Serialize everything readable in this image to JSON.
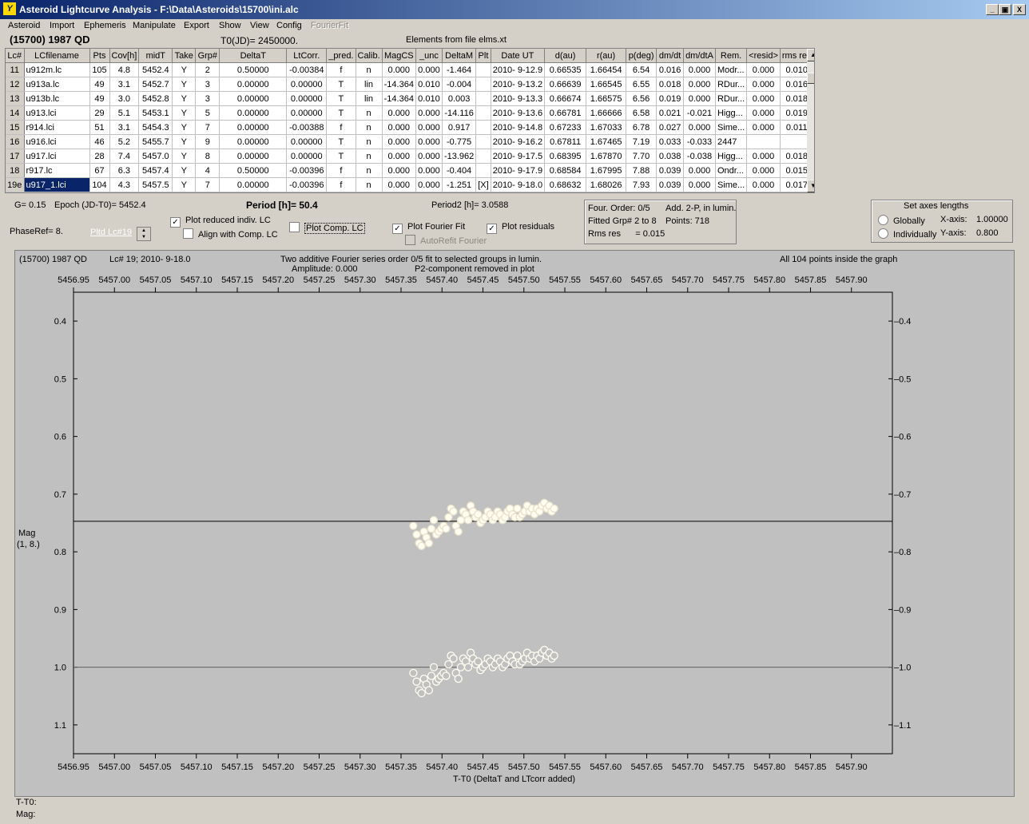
{
  "window": {
    "title": "Asteroid Lightcurve Analysis - F:\\Data\\Asteroids\\15700\\ini.alc",
    "buttons": [
      "_",
      "▣",
      "X"
    ]
  },
  "menu": [
    "Asteroid",
    "Import",
    "Ephemeris",
    "Manipulate",
    "Export",
    "Show",
    "View",
    "Config",
    "FourierFit"
  ],
  "header": {
    "asteroid": "(15700) 1987 QD",
    "t0": "T0(JD)= 2450000.",
    "elements": "Elements from file elms.xt"
  },
  "table": {
    "columns": [
      "Lc#",
      "LCfilename",
      "Pts",
      "Cov[h]",
      "midT",
      "Take",
      "Grp#",
      "DeltaT",
      "LtCorr.",
      "_pred.",
      "Calib.",
      "MagCS",
      "_unc",
      "DeltaM",
      "Plt",
      "Date UT",
      "d(au)",
      "r(au)",
      "p(deg)",
      "dm/dt",
      "dm/dtA",
      "Rem.",
      "<resid>",
      "rms res"
    ],
    "rows": [
      [
        "11",
        "u912m.lc",
        "105",
        "4.8",
        "5452.4",
        "Y",
        "2",
        "0.50000",
        "-0.00384",
        "f",
        "n",
        "0.000",
        "0.000",
        "-1.464",
        "",
        "2010- 9-12.9",
        "0.66535",
        "1.66454",
        "6.54",
        "0.016",
        "0.000",
        "Modr...",
        "0.000",
        "0.010"
      ],
      [
        "12",
        "u913a.lc",
        "49",
        "3.1",
        "5452.7",
        "Y",
        "3",
        "0.00000",
        "0.00000",
        "T",
        "lin",
        "-14.364",
        "0.010",
        "-0.004",
        "",
        "2010- 9-13.2",
        "0.66639",
        "1.66545",
        "6.55",
        "0.018",
        "0.000",
        "RDur...",
        "0.000",
        "0.016"
      ],
      [
        "13",
        "u913b.lc",
        "49",
        "3.0",
        "5452.8",
        "Y",
        "3",
        "0.00000",
        "0.00000",
        "T",
        "lin",
        "-14.364",
        "0.010",
        "0.003",
        "",
        "2010- 9-13.3",
        "0.66674",
        "1.66575",
        "6.56",
        "0.019",
        "0.000",
        "RDur...",
        "0.000",
        "0.018"
      ],
      [
        "14",
        "u913.lci",
        "29",
        "5.1",
        "5453.1",
        "Y",
        "5",
        "0.00000",
        "0.00000",
        "T",
        "n",
        "0.000",
        "0.000",
        "-14.116",
        "",
        "2010- 9-13.6",
        "0.66781",
        "1.66666",
        "6.58",
        "0.021",
        "-0.021",
        "Higg...",
        "0.000",
        "0.019"
      ],
      [
        "15",
        "r914.lci",
        "51",
        "3.1",
        "5454.3",
        "Y",
        "7",
        "0.00000",
        "-0.00388",
        "f",
        "n",
        "0.000",
        "0.000",
        "0.917",
        "",
        "2010- 9-14.8",
        "0.67233",
        "1.67033",
        "6.78",
        "0.027",
        "0.000",
        "Sime...",
        "0.000",
        "0.011"
      ],
      [
        "16",
        "u916.lci",
        "46",
        "5.2",
        "5455.7",
        "Y",
        "9",
        "0.00000",
        "0.00000",
        "T",
        "n",
        "0.000",
        "0.000",
        "-0.775",
        "",
        "2010- 9-16.2",
        "0.67811",
        "1.67465",
        "7.19",
        "0.033",
        "-0.033",
        "2447",
        "",
        ""
      ],
      [
        "17",
        "u917.lci",
        "28",
        "7.4",
        "5457.0",
        "Y",
        "8",
        "0.00000",
        "0.00000",
        "T",
        "n",
        "0.000",
        "0.000",
        "-13.962",
        "",
        "2010- 9-17.5",
        "0.68395",
        "1.67870",
        "7.70",
        "0.038",
        "-0.038",
        "Higg...",
        "0.000",
        "0.018"
      ],
      [
        "18",
        "r917.lc",
        "67",
        "6.3",
        "5457.4",
        "Y",
        "4",
        "0.50000",
        "-0.00396",
        "f",
        "n",
        "0.000",
        "0.000",
        "-0.404",
        "",
        "2010- 9-17.9",
        "0.68584",
        "1.67995",
        "7.88",
        "0.039",
        "0.000",
        "Ondr...",
        "0.000",
        "0.015"
      ],
      [
        "19e",
        "u917_1.lci",
        "104",
        "4.3",
        "5457.5",
        "Y",
        "7",
        "0.00000",
        "-0.00396",
        "f",
        "n",
        "0.000",
        "0.000",
        "-1.251",
        "[X]",
        "2010- 9-18.0",
        "0.68632",
        "1.68026",
        "7.93",
        "0.039",
        "0.000",
        "Sime...",
        "0.000",
        "0.017"
      ]
    ]
  },
  "controls": {
    "g_value": "G= 0.15",
    "epoch": "Epoch (JD-T0)= 5452.4",
    "period": "Period [h]= 50.4",
    "period2": "Period2 [h]= 3.0588",
    "phaseref": "PhaseRef= 8.",
    "pltd_lc": "Pltd Lc#19",
    "plot_reduced": "Plot reduced indiv. LC",
    "align_comp": "Align with Comp. LC",
    "plot_comp": "Plot Comp. LC",
    "plot_fourier": "Plot Fourier Fit",
    "autorefit": "AutoRefit Fourier",
    "plot_residuals": "Plot residuals"
  },
  "fourier_info": {
    "order": "Four. Order:  0/5",
    "mode": "Add. 2-P, in lumin.",
    "fitted": "Fitted Grp# 2 to 8",
    "points": "Points: 718",
    "rms": "Rms res      = 0.015"
  },
  "axes_box": {
    "title": "Set axes lengths",
    "globally": "Globally",
    "individually": "Individually",
    "x_label": "X-axis:",
    "x_value": "1.00000",
    "y_label": "Y-axis:",
    "y_value": "0.800"
  },
  "plot": {
    "asteroid": "(15700) 1987 QD",
    "lc_info": "Lc# 19; 2010- 9-18.0",
    "fit_desc": "Two additive Fourier series order 0/5 fit to selected groups in lumin.",
    "amplitude": "Amplitude: 0.000",
    "p2_removed": "P2-component removed in plot",
    "points_inside": "All 104 points inside the graph",
    "ylabel_1": "Mag",
    "ylabel_2": "(1, 8.)",
    "xlabel": "T-T0 (DeltaT and LTcorr added)",
    "tt0_label": "T-T0:",
    "mag_label": "Mag:"
  },
  "chart_data": {
    "type": "scatter",
    "x_ticks": [
      "5456.95",
      "5457.00",
      "5457.05",
      "5457.10",
      "5457.15",
      "5457.20",
      "5457.25",
      "5457.30",
      "5457.35",
      "5457.40",
      "5457.45",
      "5457.50",
      "5457.55",
      "5457.60",
      "5457.65",
      "5457.70",
      "5457.75",
      "5457.80",
      "5457.85",
      "5457.90"
    ],
    "y_ticks": [
      "0.4",
      "0.5",
      "0.6",
      "0.7",
      "0.8",
      "0.9",
      "1.0",
      "1.1"
    ],
    "xlim": [
      5456.95,
      5457.95
    ],
    "ylim": [
      0.35,
      1.15
    ],
    "y_inverted": true,
    "grid": false,
    "fourier_fit_level": 0.747,
    "residual_zero_level": 1.0,
    "marker_color": "#fffdf0",
    "series": [
      {
        "x": [
          5457.365,
          5457.369,
          5457.372,
          5457.375,
          5457.378,
          5457.381,
          5457.384,
          5457.387,
          5457.39,
          5457.393,
          5457.396,
          5457.399,
          5457.402,
          5457.405,
          5457.408,
          5457.411,
          5457.414,
          5457.417,
          5457.42,
          5457.423,
          5457.426,
          5457.429,
          5457.432,
          5457.435,
          5457.438,
          5457.441,
          5457.444,
          5457.447,
          5457.45,
          5457.453,
          5457.456,
          5457.459,
          5457.462,
          5457.465,
          5457.468,
          5457.471,
          5457.474,
          5457.477,
          5457.48,
          5457.483,
          5457.486,
          5457.489,
          5457.492,
          5457.495,
          5457.498,
          5457.501,
          5457.504,
          5457.507,
          5457.51,
          5457.513,
          5457.516,
          5457.519,
          5457.522,
          5457.525,
          5457.528,
          5457.531,
          5457.534,
          5457.537
        ],
        "y": [
          0.755,
          0.77,
          0.785,
          0.79,
          0.765,
          0.775,
          0.785,
          0.76,
          0.745,
          0.77,
          0.765,
          0.76,
          0.755,
          0.76,
          0.74,
          0.725,
          0.73,
          0.755,
          0.765,
          0.745,
          0.73,
          0.735,
          0.745,
          0.72,
          0.73,
          0.74,
          0.735,
          0.75,
          0.745,
          0.74,
          0.73,
          0.735,
          0.745,
          0.74,
          0.73,
          0.735,
          0.745,
          0.74,
          0.73,
          0.725,
          0.735,
          0.74,
          0.725,
          0.74,
          0.735,
          0.73,
          0.72,
          0.73,
          0.725,
          0.735,
          0.725,
          0.73,
          0.72,
          0.715,
          0.725,
          0.72,
          0.73,
          0.725
        ],
        "filled": true
      },
      {
        "x": [
          5457.365,
          5457.369,
          5457.372,
          5457.375,
          5457.378,
          5457.381,
          5457.384,
          5457.387,
          5457.39,
          5457.393,
          5457.396,
          5457.399,
          5457.402,
          5457.405,
          5457.408,
          5457.411,
          5457.414,
          5457.417,
          5457.42,
          5457.423,
          5457.426,
          5457.429,
          5457.432,
          5457.435,
          5457.438,
          5457.441,
          5457.444,
          5457.447,
          5457.45,
          5457.453,
          5457.456,
          5457.459,
          5457.462,
          5457.465,
          5457.468,
          5457.471,
          5457.474,
          5457.477,
          5457.48,
          5457.483,
          5457.486,
          5457.489,
          5457.492,
          5457.495,
          5457.498,
          5457.501,
          5457.504,
          5457.507,
          5457.51,
          5457.513,
          5457.516,
          5457.519,
          5457.522,
          5457.525,
          5457.528,
          5457.531,
          5457.534,
          5457.537
        ],
        "y": [
          1.01,
          1.025,
          1.04,
          1.045,
          1.02,
          1.03,
          1.04,
          1.015,
          1.0,
          1.025,
          1.02,
          1.015,
          1.01,
          1.015,
          0.995,
          0.98,
          0.985,
          1.01,
          1.02,
          1.0,
          0.985,
          0.99,
          1.0,
          0.975,
          0.985,
          0.995,
          0.99,
          1.005,
          1.0,
          0.995,
          0.985,
          0.99,
          1.0,
          0.995,
          0.985,
          0.99,
          1.0,
          0.995,
          0.985,
          0.98,
          0.99,
          0.995,
          0.98,
          0.995,
          0.99,
          0.985,
          0.975,
          0.985,
          0.98,
          0.99,
          0.98,
          0.985,
          0.975,
          0.97,
          0.98,
          0.975,
          0.985,
          0.98
        ],
        "filled": false
      }
    ]
  }
}
